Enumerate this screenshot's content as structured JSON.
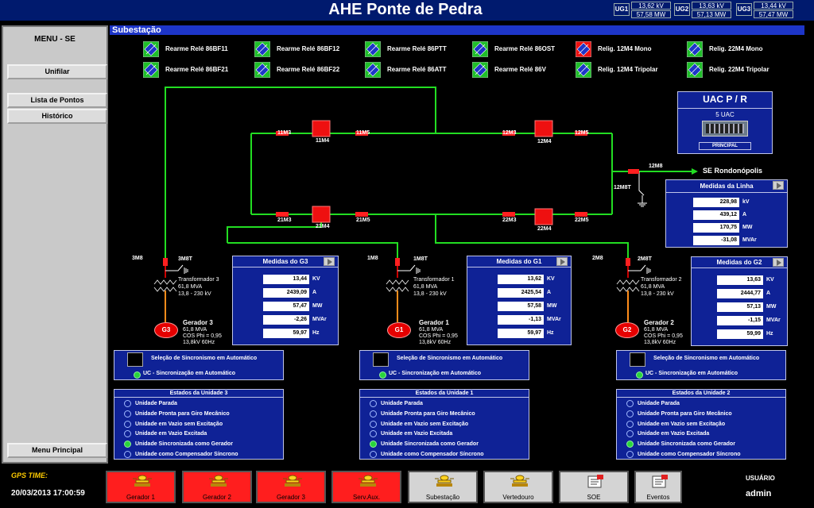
{
  "header": {
    "title": "AHE Ponte de Pedra",
    "units": [
      {
        "label": "UG1",
        "kv": "13,62 kV",
        "mw": "57,58 MW"
      },
      {
        "label": "UG2",
        "kv": "13,63 kV",
        "mw": "57,13 MW"
      },
      {
        "label": "UG3",
        "kv": "13,44 kV",
        "mw": "57,47 MW"
      }
    ]
  },
  "menu": {
    "title": "MENU - SE",
    "unifilar": "Unifilar",
    "lista_pontos": "Lista de Pontos",
    "historico": "Histórico",
    "menu_principal": "Menu Principal"
  },
  "main": {
    "section_title": "Subestação"
  },
  "resets": [
    "Rearme Relé 86BF11",
    "Rearme Relé 86BF12",
    "Rearme Relé 86PTT",
    "Rearme Relé 86OST",
    "Relig. 12M4 Mono",
    "Relig. 22M4 Mono",
    "Rearme Relé 86BF21",
    "Rearme Relé 86BF22",
    "Rearme Relé 86ATT",
    "Rearme Relé 86V",
    "Relig. 12M4 Tripolar",
    "Relig. 22M4 Tripolar"
  ],
  "diagram": {
    "breakers": {
      "b11m3": "11M3",
      "b11m4": "11M4",
      "b11m5": "11M5",
      "b12m3": "12M3",
      "b12m4": "12M4",
      "b12m5": "12M5",
      "b21m3": "21M3",
      "b21m4": "21M4",
      "b21m5": "21M5",
      "b22m3": "22M3",
      "b22m4": "22M4",
      "b22m5": "22M5",
      "b12m8": "12M8",
      "b12m8t": "12M8T",
      "b3m8": "3M8",
      "b3m8t": "3M8T",
      "b1m8": "1M8",
      "b1m8t": "1M8T",
      "b2m8": "2M8",
      "b2m8t": "2M8T"
    },
    "line_dest": "SE Rondonópolis",
    "transformers": {
      "t3": [
        "Transformador 3",
        "61,8 MVA",
        "13,8 - 230 kV"
      ],
      "t1": [
        "Transformador 1",
        "61,8 MVA",
        "13,8 - 230 kV"
      ],
      "t2": [
        "Transformador 2",
        "61,8 MVA",
        "13,8 - 230 kV"
      ]
    },
    "generators": {
      "g3": {
        "sym": "G3",
        "name": "Gerador 3",
        "l1": "61,8 MVA",
        "l2": "COS Phi = 0,95",
        "l3": "13,8kV 60Hz"
      },
      "g1": {
        "sym": "G1",
        "name": "Gerador 1",
        "l1": "61,8 MVA",
        "l2": "COS Phi = 0,95",
        "l3": "13,8kV 60Hz"
      },
      "g2": {
        "sym": "G2",
        "name": "Gerador 2",
        "l1": "61,8 MVA",
        "l2": "COS Phi = 0,95",
        "l3": "13,8kV 60Hz"
      }
    }
  },
  "uac": {
    "title": "UAC P / R",
    "sub": "5 UAC",
    "status": "PRINCIPAL"
  },
  "medidas_linha": {
    "title": "Medidas da Linha",
    "rows": [
      {
        "v": "228,98",
        "u": "kV"
      },
      {
        "v": "439,12",
        "u": "A"
      },
      {
        "v": "170,75",
        "u": "MW"
      },
      {
        "v": "-31,08",
        "u": "MVAr"
      }
    ]
  },
  "medidas": {
    "g3": {
      "title": "Medidas do G3",
      "rows": [
        {
          "v": "13,44",
          "u": "KV"
        },
        {
          "v": "2439,09",
          "u": "A"
        },
        {
          "v": "57,47",
          "u": "MW"
        },
        {
          "v": "-2,26",
          "u": "MVAr"
        },
        {
          "v": "59,97",
          "u": "Hz"
        }
      ]
    },
    "g1": {
      "title": "Medidas do G1",
      "rows": [
        {
          "v": "13,62",
          "u": "KV"
        },
        {
          "v": "2425,54",
          "u": "A"
        },
        {
          "v": "57,58",
          "u": "MW"
        },
        {
          "v": "-1,13",
          "u": "MVAr"
        },
        {
          "v": "59,97",
          "u": "Hz"
        }
      ]
    },
    "g2": {
      "title": "Medidas do G2",
      "rows": [
        {
          "v": "13,63",
          "u": "KV"
        },
        {
          "v": "2444,77",
          "u": "A"
        },
        {
          "v": "57,13",
          "u": "MW"
        },
        {
          "v": "-1,15",
          "u": "MVAr"
        },
        {
          "v": "59,99",
          "u": "Hz"
        }
      ]
    }
  },
  "sync": {
    "title": "Seleção de Sincronismo em Automático",
    "status": "UC - Sincronização em Automático"
  },
  "estados": {
    "u3": "Estados da Unidade 3",
    "u1": "Estados da Unidade 1",
    "u2": "Estados da Unidade 2",
    "items": [
      "Unidade Parada",
      "Unidade Pronta para Giro Mecânico",
      "Unidade em Vazio sem Excitação",
      "Unidade em Vazio Excitada",
      "Unidade Sincronizada como Gerador",
      "Unidade como Compensador Síncrono"
    ],
    "active_index": 4
  },
  "footer": {
    "gps_label": "GPS TIME:",
    "gps_value": "20/03/2013 17:00:59",
    "buttons": [
      "Gerador 1",
      "Gerador 2",
      "Gerador 3",
      "Serv.Aux.",
      "Subestação",
      "Vertedouro",
      "SOE",
      "Eventos"
    ],
    "user_label": "USUÁRIO",
    "user_value": "admin"
  },
  "colors": {
    "bus": "#22dd22",
    "breaker": "#ff1111",
    "panel": "#0f2296",
    "header": "#001a6e"
  }
}
